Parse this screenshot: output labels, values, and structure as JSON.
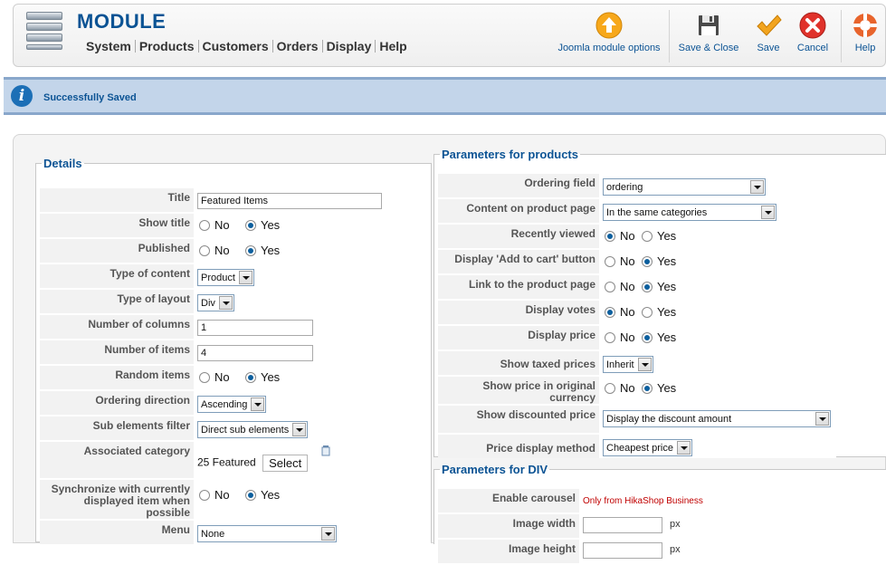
{
  "header": {
    "title": "MODULE",
    "nav": [
      "System",
      "Products",
      "Customers",
      "Orders",
      "Display",
      "Help"
    ],
    "toolbar": {
      "options_label": "Joomla module options",
      "save_close_label": "Save & Close",
      "save_label": "Save",
      "cancel_label": "Cancel",
      "help_label": "Help"
    }
  },
  "message": {
    "text": "Successfully Saved"
  },
  "details": {
    "legend": "Details",
    "title_label": "Title",
    "title_value": "Featured Items",
    "show_title_label": "Show title",
    "published_label": "Published",
    "type_of_content_label": "Type of content",
    "type_of_content_value": "Product",
    "type_of_layout_label": "Type of layout",
    "type_of_layout_value": "Div",
    "columns_label": "Number of columns",
    "columns_value": "1",
    "items_label": "Number of items",
    "items_value": "4",
    "random_label": "Random items",
    "ordering_dir_label": "Ordering direction",
    "ordering_dir_value": "Ascending",
    "sub_filter_label": "Sub elements filter",
    "sub_filter_value": "Direct sub elements",
    "assoc_cat_label": "Associated category",
    "assoc_cat_value": "25 Featured",
    "select_button": "Select",
    "sync_label": "Synchronize with currently displayed item when possible",
    "menu_label": "Menu",
    "menu_value": "None"
  },
  "radio_labels": {
    "no": "No",
    "yes": "Yes"
  },
  "products": {
    "legend": "Parameters for products",
    "ordering_field_label": "Ordering field",
    "ordering_field_value": "ordering",
    "content_page_label": "Content on product page",
    "content_page_value": "In the same categories",
    "recently_viewed_label": "Recently viewed",
    "add_to_cart_label": "Display 'Add to cart' button",
    "link_label": "Link to the product page",
    "votes_label": "Display votes",
    "price_label": "Display price",
    "taxed_label": "Show taxed prices",
    "taxed_value": "Inherit",
    "orig_currency_label": "Show price in original currency",
    "discount_label": "Show discounted price",
    "discount_value": "Display the discount amount",
    "price_method_label": "Price display method",
    "price_method_value": "Cheapest price"
  },
  "div_params": {
    "legend": "Parameters for DIV",
    "carousel_label": "Enable carousel",
    "carousel_note": "Only from HikaShop Business",
    "width_label": "Image width",
    "height_label": "Image height",
    "unit": "px"
  },
  "colors": {
    "brand_blue": "#0b5394",
    "message_bg": "#c3d5ea",
    "note_red": "#c00000"
  }
}
